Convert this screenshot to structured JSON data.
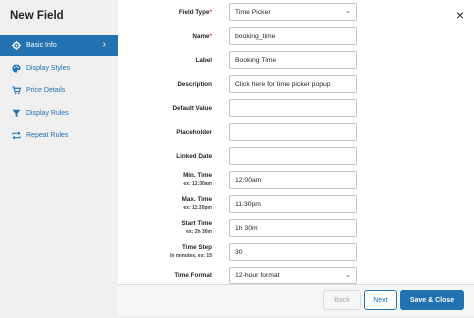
{
  "modal": {
    "title": "New Field",
    "close_icon": "×"
  },
  "sidebar": {
    "items": [
      {
        "label": "Basic Info",
        "icon": "gear-icon",
        "active": true
      },
      {
        "label": "Display Styles",
        "icon": "palette-icon",
        "active": false
      },
      {
        "label": "Price Details",
        "icon": "cart-icon",
        "active": false
      },
      {
        "label": "Display Rules",
        "icon": "filter-icon",
        "active": false
      },
      {
        "label": "Repeat Rules",
        "icon": "repeat-icon",
        "active": false
      }
    ]
  },
  "form": {
    "field_type": {
      "label": "Field Type",
      "required": "*",
      "value": "Time Picker"
    },
    "name": {
      "label": "Name",
      "required": "*",
      "value": "booking_time"
    },
    "label": {
      "label": "Label",
      "value": "Booking Time"
    },
    "description": {
      "label": "Description",
      "value": "Click here for time picker popup"
    },
    "default_value": {
      "label": "Default Value",
      "value": ""
    },
    "placeholder": {
      "label": "Placeholder",
      "value": ""
    },
    "linked_date": {
      "label": "Linked Date",
      "value": ""
    },
    "min_time": {
      "label": "Min. Time",
      "hint": "ex: 12:30am",
      "value": "12:00am"
    },
    "max_time": {
      "label": "Max. Time",
      "hint": "ex: 11:30pm",
      "value": "11:30pm"
    },
    "start_time": {
      "label": "Start Time",
      "hint": "ex: 2h 30m",
      "value": "1h 30m"
    },
    "time_step": {
      "label": "Time Step",
      "hint": "In minutes, ex: 15",
      "value": "30"
    },
    "time_format": {
      "label": "Time Format",
      "value": "12-hour format"
    }
  },
  "footer": {
    "back": "Back",
    "next": "Next",
    "save_close": "Save & Close"
  },
  "colors": {
    "accent": "#2271b1",
    "required": "#d63638",
    "sidebar_bg": "#f0f0f1"
  }
}
